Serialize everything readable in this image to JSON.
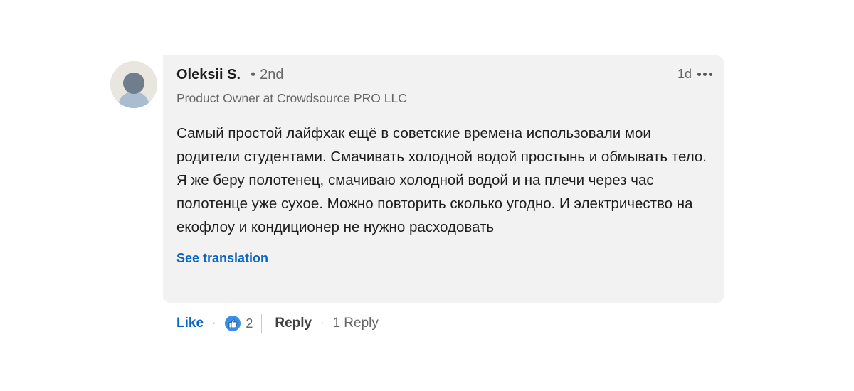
{
  "comment": {
    "author": {
      "name": "Oleksii S.",
      "degree_bullet": "•",
      "degree": "2nd",
      "headline": "Product Owner at Crowdsource PRO LLC",
      "avatar_icon": "default-person-avatar-icon"
    },
    "time": "1d",
    "more_icon": "ellipsis-horizontal-icon",
    "text": "Самый простой лайфхак ещё в советские времена использовали мои родители студентами. Смачивать холодной водой простынь и обмывать тело. Я же беру полотенец, смачиваю холодной водой и на плечи через час полотенце уже сухое. Можно повторить сколько угодно. И электричество на екофлоу и кондиционер не нужно расходовать",
    "see_translation": "See translation"
  },
  "actions": {
    "like_label": "Like",
    "sep": "·",
    "reaction_icon": "thumbs-up-reaction-icon",
    "reaction_count": "2",
    "reply_label": "Reply",
    "reply_count_label": "1 Reply"
  },
  "colors": {
    "accent": "#0a66c2",
    "bubble_bg": "#f2f2f2",
    "text": "#1d1d1d",
    "muted": "#666666"
  }
}
